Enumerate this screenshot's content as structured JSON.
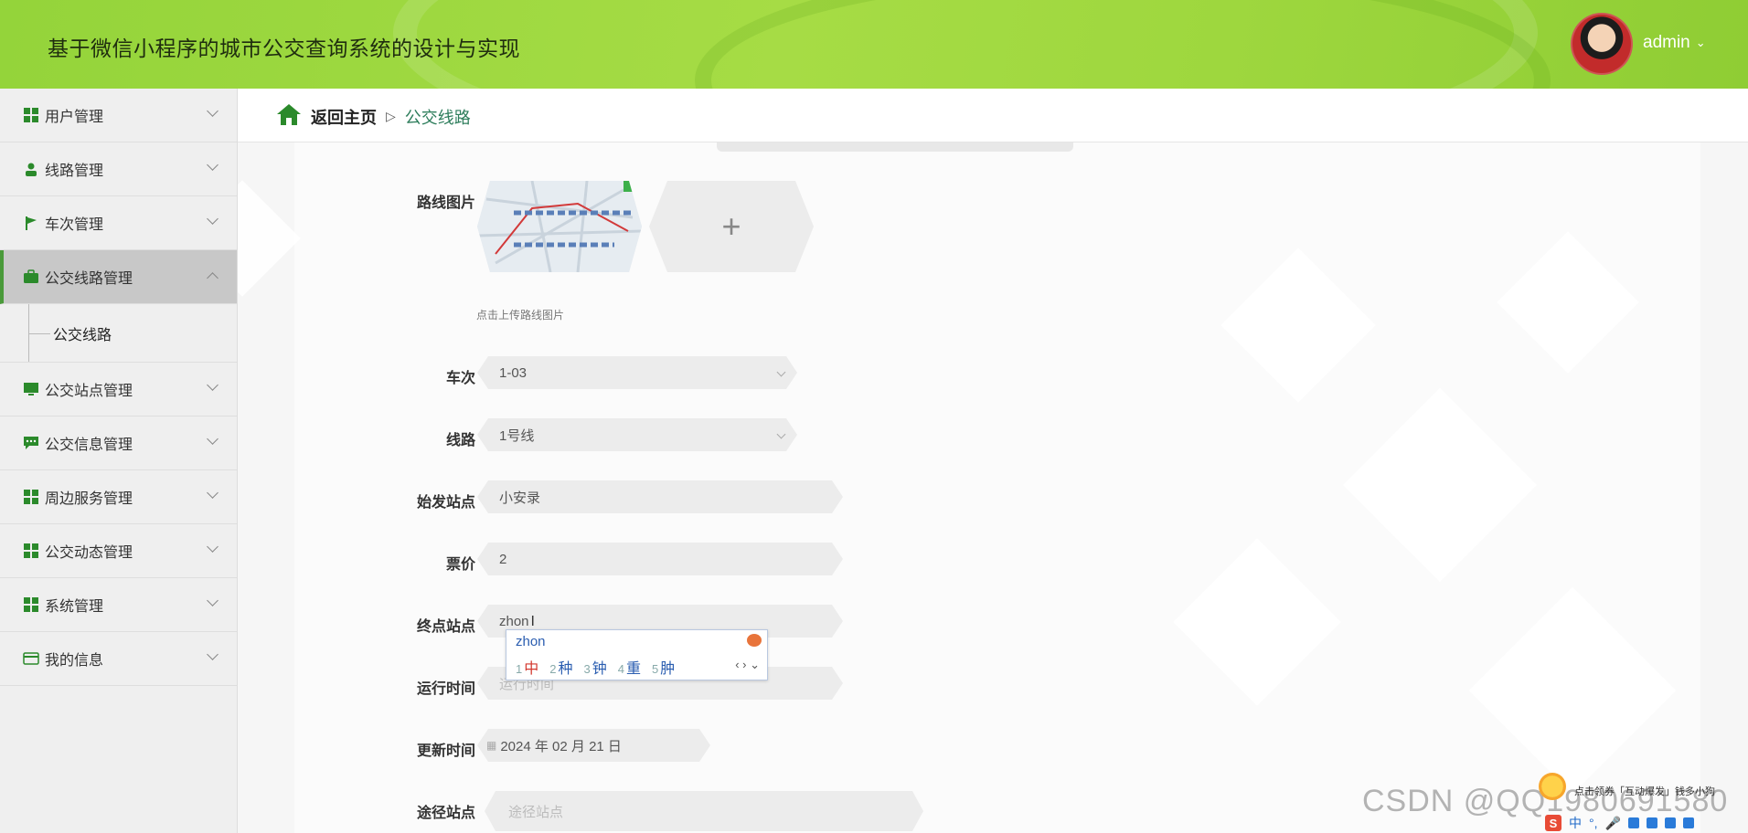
{
  "header": {
    "title": "基于微信小程序的城市公交查询系统的设计与实现",
    "username": "admin"
  },
  "sidebar": {
    "items": [
      {
        "label": "用户管理",
        "icon": "grid-icon"
      },
      {
        "label": "线路管理",
        "icon": "user-icon"
      },
      {
        "label": "车次管理",
        "icon": "flag-icon"
      },
      {
        "label": "公交线路管理",
        "icon": "briefcase-icon",
        "active": true
      },
      {
        "label": "公交站点管理",
        "icon": "monitor-icon"
      },
      {
        "label": "公交信息管理",
        "icon": "chat-icon"
      },
      {
        "label": "周边服务管理",
        "icon": "grid-icon"
      },
      {
        "label": "公交动态管理",
        "icon": "grid-icon"
      },
      {
        "label": "系统管理",
        "icon": "grid-icon"
      },
      {
        "label": "我的信息",
        "icon": "card-icon"
      }
    ],
    "submenu_label": "公交线路"
  },
  "breadcrumb": {
    "back": "返回主页",
    "separator": "▷",
    "current": "公交线路"
  },
  "form": {
    "route_image_label": "路线图片",
    "route_image_hint": "点击上传路线图片",
    "upload_plus": "+",
    "trip_label": "车次",
    "trip_value": "1-03",
    "line_label": "线路",
    "line_value": "1号线",
    "start_label": "始发站点",
    "start_value": "小安录",
    "fare_label": "票价",
    "fare_value": "2",
    "end_label": "终点站点",
    "end_value": "zhon",
    "runtime_label": "运行时间",
    "runtime_placeholder": "运行时间",
    "update_label": "更新时间",
    "update_value": "2024 年 02 月 21 日",
    "via_label": "途径站点",
    "via_placeholder": "途径站点"
  },
  "ime": {
    "typed": "zhon",
    "candidates": [
      {
        "num": "1",
        "char": "中"
      },
      {
        "num": "2",
        "char": "种"
      },
      {
        "num": "3",
        "char": "钟"
      },
      {
        "num": "4",
        "char": "重"
      },
      {
        "num": "5",
        "char": "肿"
      }
    ],
    "nav": "‹ › ⌄"
  },
  "overlay": {
    "watermark": "CSDN @QQ1980691580",
    "promo": "点击领券「互动爆发」钱多小狗"
  },
  "tray": {
    "ime_lang": "中",
    "punct": "°,"
  },
  "colors": {
    "header_green": "#9ed73e",
    "accent_green": "#2b8a2b",
    "breadcrumb_current": "#2d7d5b"
  }
}
